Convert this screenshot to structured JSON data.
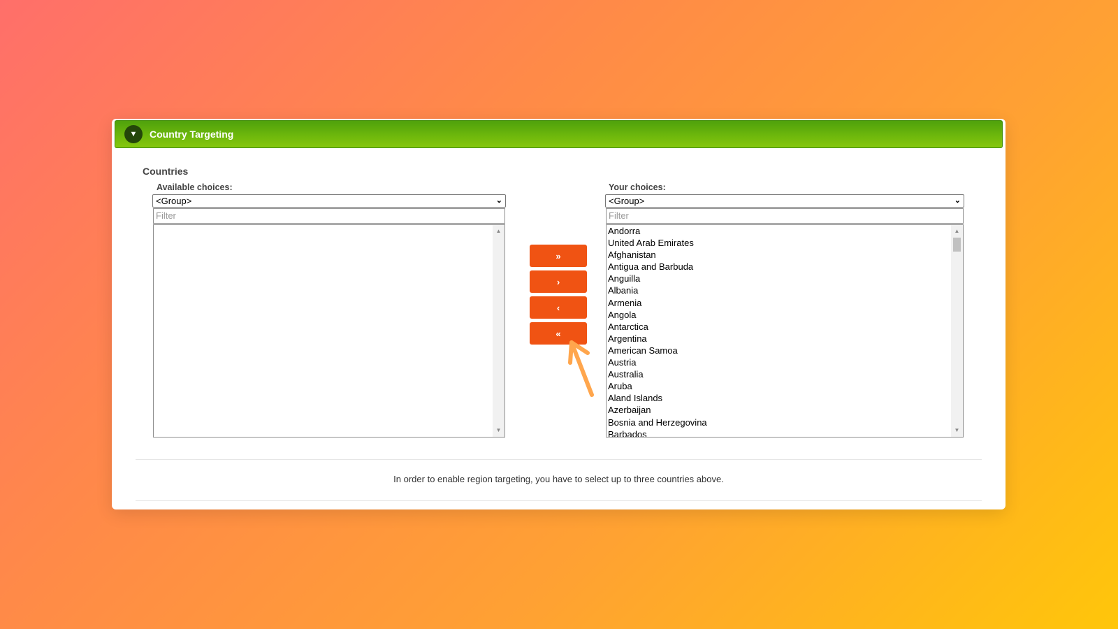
{
  "panel": {
    "title": "Country Targeting",
    "toggle_icon": "▼",
    "section_label": "Countries"
  },
  "available": {
    "label": "Available choices:",
    "group_value": "<Group>",
    "filter_placeholder": "Filter",
    "options": []
  },
  "chosen": {
    "label": "Your choices:",
    "group_value": "<Group>",
    "filter_placeholder": "Filter",
    "options": [
      "Andorra",
      "United Arab Emirates",
      "Afghanistan",
      "Antigua and Barbuda",
      "Anguilla",
      "Albania",
      "Armenia",
      "Angola",
      "Antarctica",
      "Argentina",
      "American Samoa",
      "Austria",
      "Australia",
      "Aruba",
      "Aland Islands",
      "Azerbaijan",
      "Bosnia and Herzegovina",
      "Barbados"
    ]
  },
  "buttons": {
    "add_all": "»",
    "add_one": "›",
    "remove_one": "‹",
    "remove_all": "«"
  },
  "note": "In order to enable region targeting, you have to select up to three countries above.",
  "colors": {
    "header_green": "#6db70c",
    "button_orange": "#f05313",
    "annotation_arrow": "#ffa64d"
  },
  "annotation_icon": "arrow-pointer-icon"
}
